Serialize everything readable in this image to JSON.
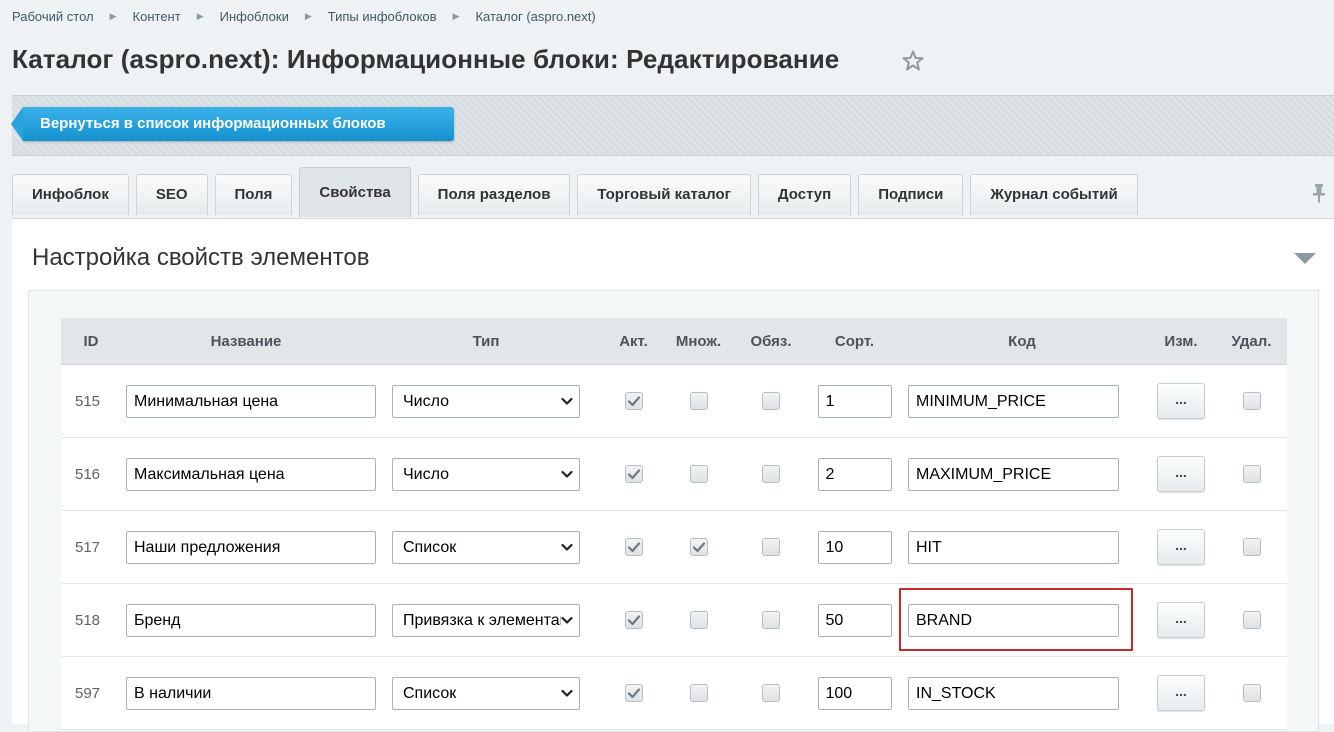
{
  "breadcrumb": [
    "Рабочий стол",
    "Контент",
    "Инфоблоки",
    "Типы инфоблоков",
    "Каталог (aspro.next)"
  ],
  "page_title": "Каталог (aspro.next): Информационные блоки: Редактирование",
  "toolbar": {
    "back_label": "Вернуться в список информационных блоков"
  },
  "tabs": [
    "Инфоблок",
    "SEO",
    "Поля",
    "Свойства",
    "Поля разделов",
    "Торговый каталог",
    "Доступ",
    "Подписи",
    "Журнал событий"
  ],
  "active_tab": "Свойства",
  "section_title": "Настройка свойств элементов",
  "table": {
    "headers": [
      "ID",
      "Название",
      "Тип",
      "Акт.",
      "Множ.",
      "Обяз.",
      "Сорт.",
      "Код",
      "Изм.",
      "Удал."
    ],
    "edit_label": "...",
    "rows": [
      {
        "id": "515",
        "name": "Минимальная цена",
        "type": "Число",
        "active": true,
        "multiple": false,
        "required": false,
        "sort": "1",
        "code": "MINIMUM_PRICE",
        "delete": false
      },
      {
        "id": "516",
        "name": "Максимальная цена",
        "type": "Число",
        "active": true,
        "multiple": false,
        "required": false,
        "sort": "2",
        "code": "MAXIMUM_PRICE",
        "delete": false
      },
      {
        "id": "517",
        "name": "Наши предложения",
        "type": "Список",
        "active": true,
        "multiple": true,
        "required": false,
        "sort": "10",
        "code": "HIT",
        "delete": false
      },
      {
        "id": "518",
        "name": "Бренд",
        "type": "Привязка к элементам",
        "active": true,
        "multiple": false,
        "required": false,
        "sort": "50",
        "code": "BRAND",
        "delete": false
      },
      {
        "id": "597",
        "name": "В наличии",
        "type": "Список",
        "active": true,
        "multiple": false,
        "required": false,
        "sort": "100",
        "code": "IN_STOCK",
        "delete": false
      }
    ]
  },
  "colors": {
    "accent": "#1fa1de",
    "highlight": "#c32c2c",
    "header_bg": "#e1e6e9"
  }
}
